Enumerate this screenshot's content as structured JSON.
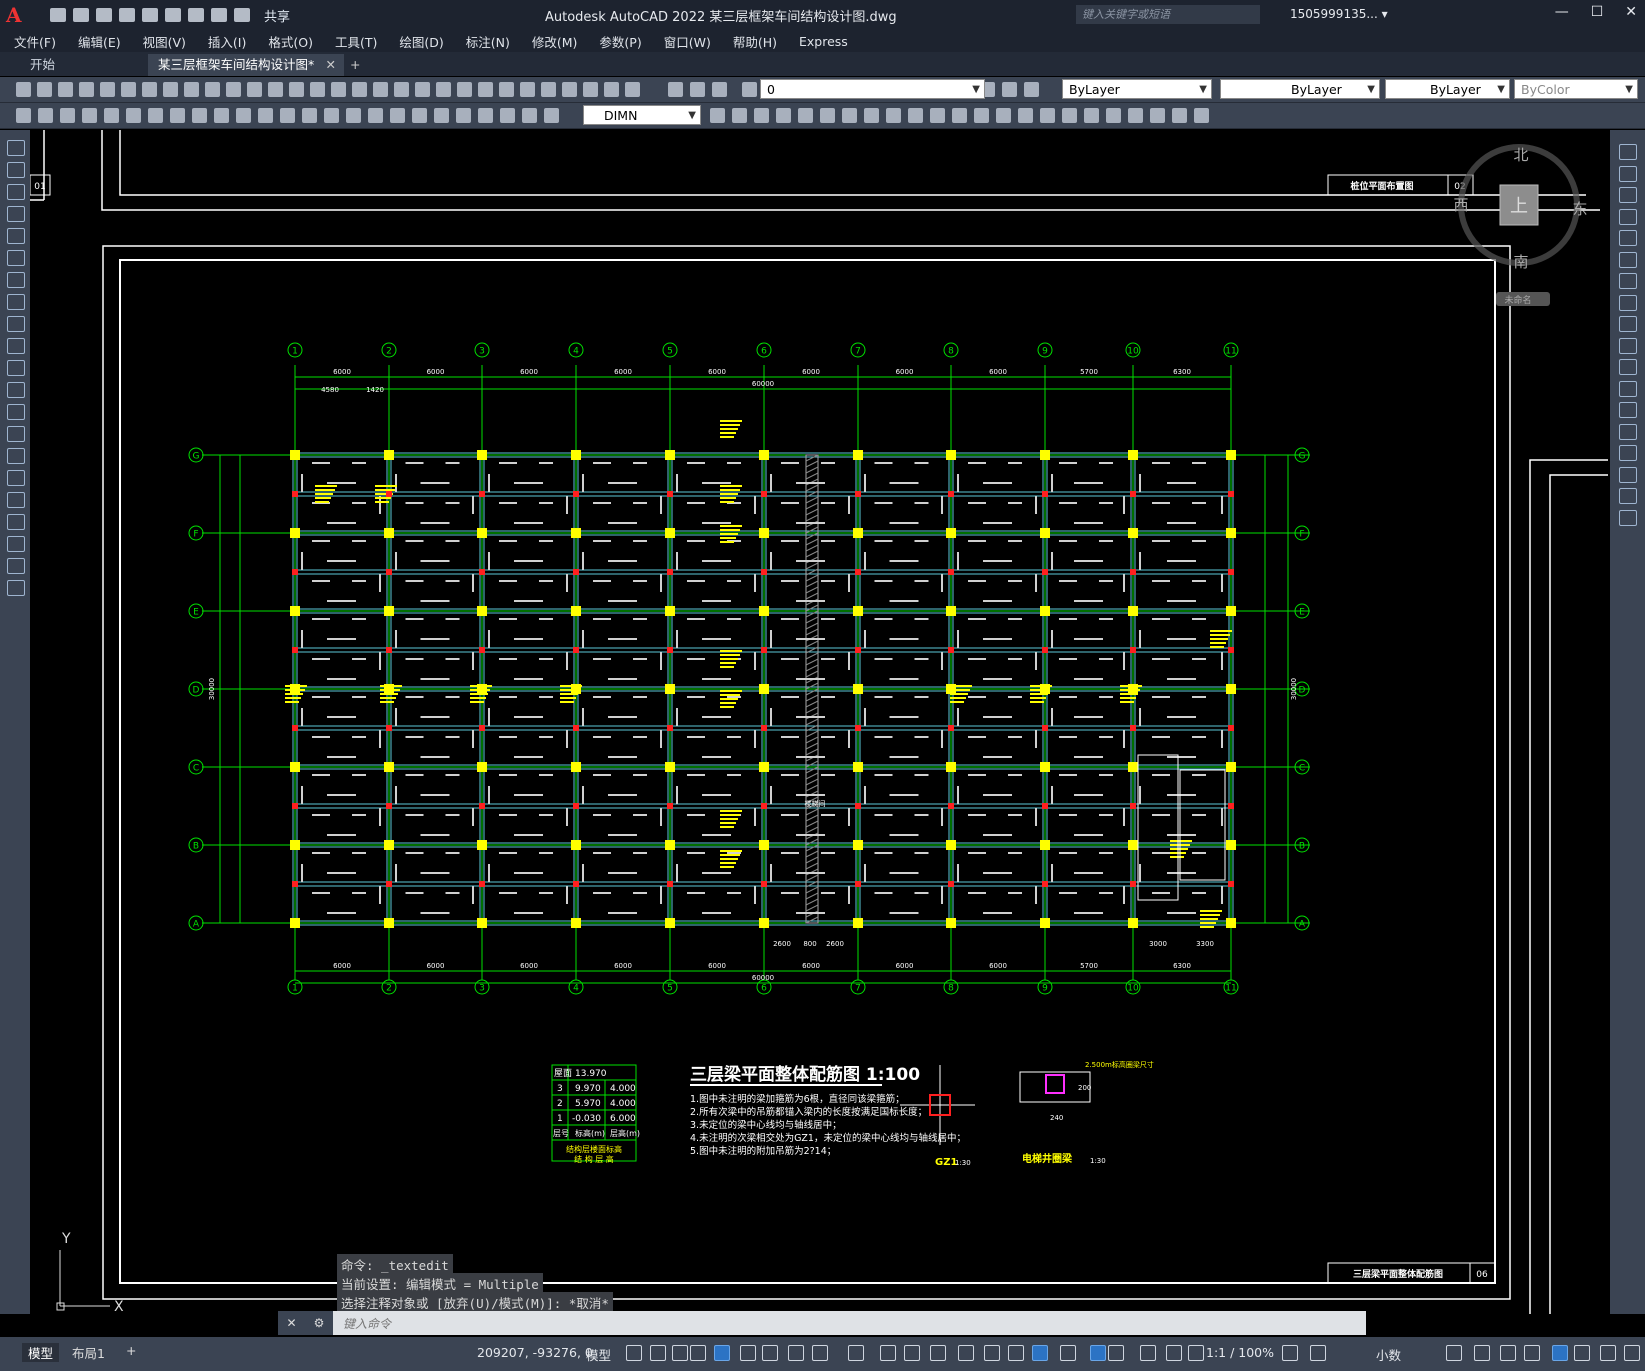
{
  "titlebar": {
    "share": "共享",
    "app_title": "Autodesk AutoCAD 2022    某三层框架车间结构设计图.dwg",
    "search_placeholder": "键入关键字或短语",
    "user": "1505999135... ▾"
  },
  "menu": [
    "文件(F)",
    "编辑(E)",
    "视图(V)",
    "插入(I)",
    "格式(O)",
    "工具(T)",
    "绘图(D)",
    "标注(N)",
    "修改(M)",
    "参数(P)",
    "窗口(W)",
    "帮助(H)",
    "Express"
  ],
  "tabs": {
    "home": "开始",
    "active": "某三层框架车间结构设计图*",
    "close": "✕",
    "plus": "+"
  },
  "toolbar": {
    "layer": "0",
    "color": "ByLayer",
    "linetype": "ByLayer",
    "lineweight": "ByLayer",
    "plotstyle": "ByColor",
    "dimstyle": "DIMN"
  },
  "viewcube": {
    "north": "北",
    "south": "南",
    "east": "东",
    "west": "西",
    "top": "上",
    "wcs": "未命名"
  },
  "drawing": {
    "title": "三层梁平面整体配筋图  1:100",
    "sheet_top_title": "桩位平面布置图",
    "sheet_top_no": "02",
    "sheet_left_no": "01",
    "sheet_title": "三层梁平面整体配筋图",
    "sheet_no": "06",
    "grid_numbers": [
      "1",
      "2",
      "3",
      "4",
      "5",
      "6",
      "7",
      "8",
      "9",
      "10",
      "11"
    ],
    "grid_letters": [
      "G",
      "F",
      "E",
      "D",
      "C",
      "B",
      "A"
    ],
    "span_dims": [
      "6000",
      "6000",
      "6000",
      "6000",
      "6000",
      "6000",
      "6000",
      "6000",
      "5700",
      "6300"
    ],
    "total_dim": "60000",
    "top_extra_dims": [
      "4580",
      "1420"
    ],
    "bottom_extra_dims": [
      "2600",
      "800",
      "2600"
    ],
    "bottom_right_dims": [
      "3000",
      "3300"
    ],
    "left_total": "30000",
    "right_total": "30000",
    "level_table_header": "屋面",
    "level_table_top": "13.970",
    "level_rows": [
      [
        "3",
        "9.970",
        "4.000"
      ],
      [
        "2",
        "5.970",
        "4.000"
      ],
      [
        "1",
        "-0.030",
        "6.000"
      ]
    ],
    "level_foot": [
      "层号",
      "标高(m)",
      "层高(m)"
    ],
    "level_caption": "结构层楼面标高",
    "level_caption2": "结 构 层 高",
    "notes": [
      "1.图中未注明的梁加箍筋为6根，直径同该梁箍筋；",
      "2.所有次梁中的吊筋都锚入梁内的长度按满足国标长度；",
      "3.未定位的梁中心线均与轴线居中；",
      "4.未注明的次梁相交处为GZ1，未定位的梁中心线均与轴线居中；",
      "5.图中未注明的附加吊筋为2?14；"
    ],
    "gz1_label": "GZ1",
    "gz1_scale": "1:30",
    "elevator_label": "电梯井圈梁",
    "elevator_scale": "1:30",
    "elevator_note": "2.500m标高圈梁尺寸",
    "elevator_dim": "240",
    "elevator_side_dim": "200",
    "stair_label": "楼梯间"
  },
  "cmd": {
    "line1": "命令: _textedit",
    "line2": "当前设置: 编辑模式 = Multiple",
    "line3": "选择注释对象或 [放弃(U)/模式(M)]: *取消*",
    "placeholder": "键入命令"
  },
  "ucs": {
    "x": "X",
    "y": "Y"
  },
  "status": {
    "model_tab": "模型",
    "layout_tab": "布局1",
    "plus": "+",
    "coords": "209207, -93276, 0",
    "space": "模型",
    "scale": "1:1 / 100%",
    "units": "小数"
  },
  "colors": {
    "grid": "#00e000",
    "beam": "#5cc8d8",
    "column_corner": "#ffff00",
    "column_mid": "#ff2020",
    "annot": "#ffff00",
    "frame": "#ffffff"
  }
}
